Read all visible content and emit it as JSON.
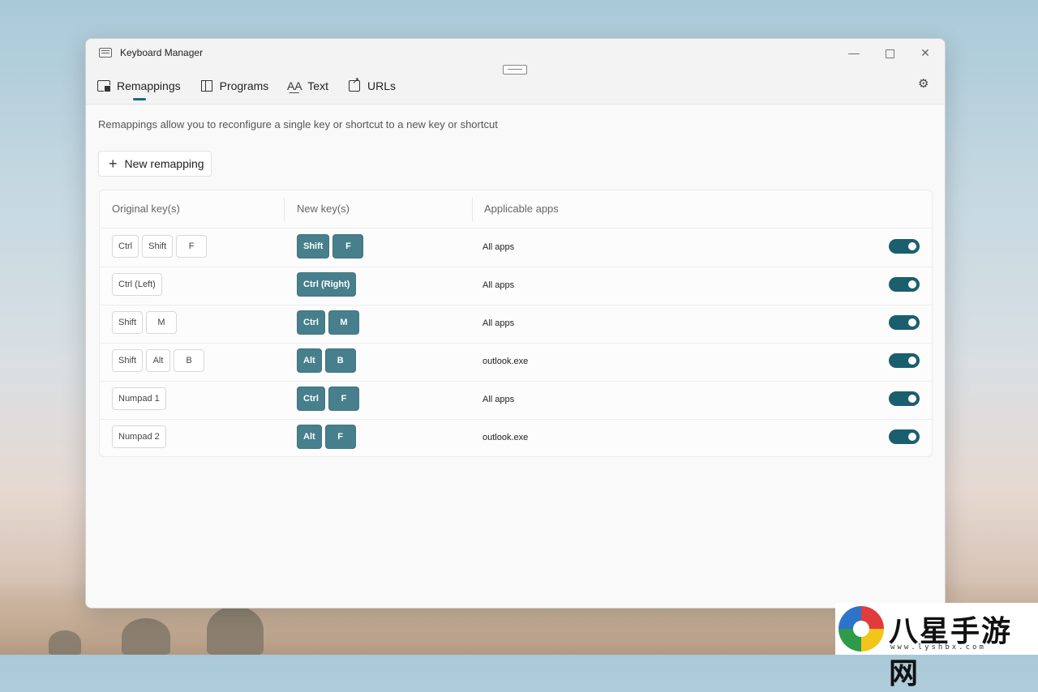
{
  "window": {
    "title": "Keyboard Manager",
    "controls": {
      "minimize": "—",
      "close": "✕"
    }
  },
  "tabs": [
    {
      "label": "Remappings",
      "icon": "remap-icon",
      "active": true
    },
    {
      "label": "Programs",
      "icon": "programs-icon"
    },
    {
      "label": "Text",
      "icon": "text-icon",
      "glyph": "A͟A"
    },
    {
      "label": "URLs",
      "icon": "url-icon"
    }
  ],
  "settings_icon": "⚙",
  "description": "Remappings allow you to reconfigure a single key or shortcut to a new key or shortcut",
  "new_button": {
    "plus": "+",
    "label": "New remapping"
  },
  "table": {
    "headers": {
      "original": "Original key(s)",
      "new": "New key(s)",
      "apps": "Applicable apps"
    },
    "rows": [
      {
        "original": [
          "Ctrl",
          "Shift",
          "F"
        ],
        "new": [
          "Shift",
          "F"
        ],
        "app": "All apps",
        "enabled": true
      },
      {
        "original": [
          "Ctrl (Left)"
        ],
        "new": [
          "Ctrl (Right)"
        ],
        "app": "All apps",
        "enabled": true
      },
      {
        "original": [
          "Shift",
          "M"
        ],
        "new": [
          "Ctrl",
          "M"
        ],
        "app": "All apps",
        "enabled": true
      },
      {
        "original": [
          "Shift",
          "Alt",
          "B"
        ],
        "new": [
          "Alt",
          "B"
        ],
        "app": "outlook.exe",
        "enabled": true
      },
      {
        "original": [
          "Numpad 1"
        ],
        "new": [
          "Ctrl",
          "F"
        ],
        "app": "All apps",
        "enabled": true
      },
      {
        "original": [
          "Numpad 2"
        ],
        "new": [
          "Alt",
          "F"
        ],
        "app": "outlook.exe",
        "enabled": true
      }
    ]
  },
  "colors": {
    "accent": "#1b5e6e",
    "new_key": "#477f8c"
  },
  "watermark": {
    "text": "八星手游网",
    "url": "www.lyshbx.com"
  }
}
